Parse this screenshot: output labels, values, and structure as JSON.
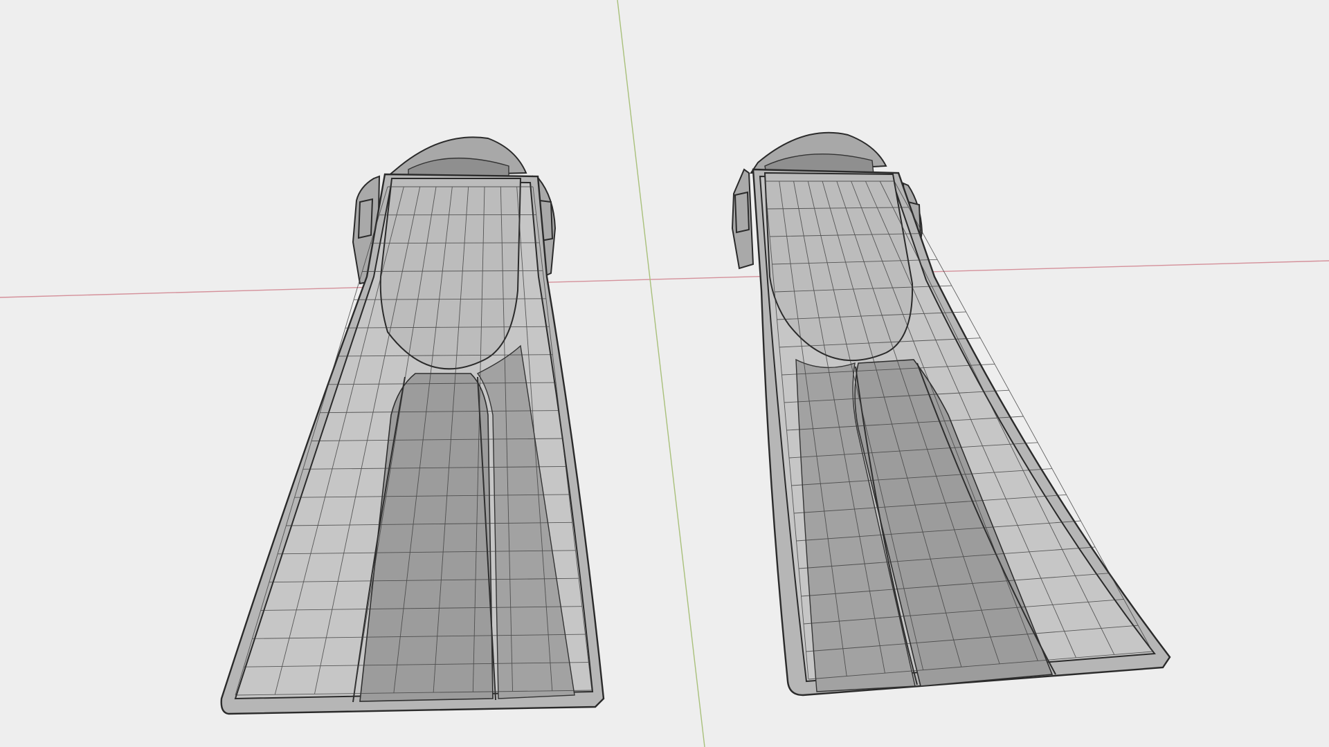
{
  "viewport": {
    "background_color": "#eeeeee",
    "axis_x_color": "#d4909a",
    "axis_y_color": "#a8c07a"
  },
  "objects": [
    {
      "name": "left-fin"
    },
    {
      "name": "right-fin"
    }
  ]
}
